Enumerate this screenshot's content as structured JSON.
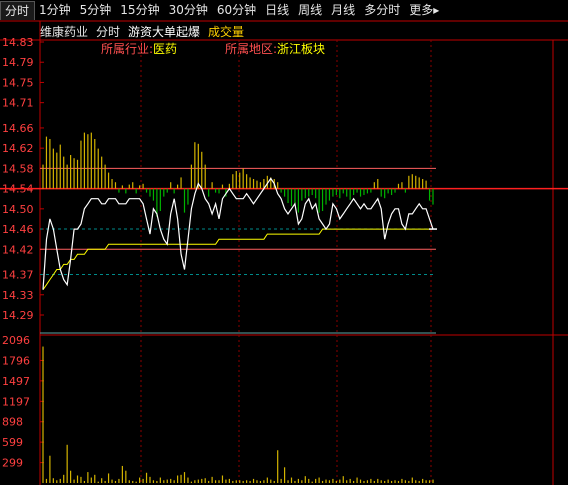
{
  "tabs": [
    {
      "label": "分时",
      "active": true
    },
    {
      "label": "1分钟"
    },
    {
      "label": "5分钟"
    },
    {
      "label": "15分钟"
    },
    {
      "label": "30分钟"
    },
    {
      "label": "60分钟"
    },
    {
      "label": "日线"
    },
    {
      "label": "周线"
    },
    {
      "label": "月线"
    },
    {
      "label": "多分时"
    },
    {
      "label": "更多▸"
    }
  ],
  "info": {
    "stock_name": "维康药业",
    "mode": "分时",
    "hot_flag": "游资大单起爆",
    "volume_label": "成交量",
    "industry_label": "所属行业:",
    "industry_value": "医药",
    "region_label": "所属地区:",
    "region_value": "浙江板块"
  },
  "colors": {
    "price_line": "#ffffff",
    "avg_line": "#ffff00",
    "up_bar": "#d4b400",
    "down_bar": "#00b400",
    "frame": "#c00000",
    "axis_text": "#ff4040",
    "volume_bar": "#d4b400"
  },
  "chart_data": [
    {
      "type": "line",
      "title": "",
      "y_ticks": [
        "14.83",
        "14.79",
        "14.75",
        "14.71",
        "14.66",
        "14.62",
        "14.58",
        "14.54",
        "14.50",
        "14.46",
        "14.42",
        "14.37",
        "14.33",
        "14.29"
      ],
      "ylim": [
        14.27,
        14.84
      ],
      "prev_close": 14.54,
      "reference_lines": [
        14.58,
        14.42
      ],
      "series": [
        {
          "key": "price",
          "values": [
            14.34,
            14.44,
            14.48,
            14.46,
            14.42,
            14.38,
            14.36,
            14.35,
            14.4,
            14.46,
            14.46,
            14.47,
            14.5,
            14.51,
            14.52,
            14.52,
            14.52,
            14.51,
            14.51,
            14.52,
            14.52,
            14.52,
            14.51,
            14.51,
            14.51,
            14.52,
            14.52,
            14.52,
            14.52,
            14.51,
            14.48,
            14.45,
            14.5,
            14.49,
            14.46,
            14.44,
            14.43,
            14.49,
            14.52,
            14.48,
            14.41,
            14.38,
            14.44,
            14.5,
            14.53,
            14.55,
            14.54,
            14.52,
            14.51,
            14.49,
            14.51,
            14.48,
            14.52,
            14.53,
            14.54,
            14.53,
            14.52,
            14.52,
            14.52,
            14.53,
            14.52,
            14.51,
            14.52,
            14.53,
            14.54,
            14.55,
            14.56,
            14.55,
            14.53,
            14.52,
            14.5,
            14.49,
            14.5,
            14.51,
            14.47,
            14.48,
            14.51,
            14.52,
            14.5,
            14.51,
            14.48,
            14.47,
            14.46,
            14.47,
            14.51,
            14.5,
            14.48,
            14.49,
            14.5,
            14.51,
            14.52,
            14.51,
            14.5,
            14.51,
            14.5,
            14.5,
            14.51,
            14.52,
            14.5,
            14.44,
            14.47,
            14.49,
            14.5,
            14.5,
            14.47,
            14.46,
            14.49,
            14.49,
            14.5,
            14.51,
            14.5,
            14.5,
            14.48,
            14.46
          ]
        },
        {
          "key": "average",
          "values": [
            14.34,
            14.35,
            14.36,
            14.37,
            14.38,
            14.38,
            14.39,
            14.39,
            14.4,
            14.4,
            14.41,
            14.41,
            14.41,
            14.42,
            14.42,
            14.42,
            14.42,
            14.42,
            14.42,
            14.43,
            14.43,
            14.43,
            14.43,
            14.43,
            14.43,
            14.43,
            14.43,
            14.43,
            14.43,
            14.43,
            14.43,
            14.43,
            14.43,
            14.43,
            14.43,
            14.43,
            14.43,
            14.43,
            14.43,
            14.43,
            14.43,
            14.43,
            14.43,
            14.43,
            14.43,
            14.43,
            14.43,
            14.43,
            14.43,
            14.43,
            14.43,
            14.44,
            14.44,
            14.44,
            14.44,
            14.44,
            14.44,
            14.44,
            14.44,
            14.44,
            14.44,
            14.44,
            14.44,
            14.44,
            14.44,
            14.45,
            14.45,
            14.45,
            14.45,
            14.45,
            14.45,
            14.45,
            14.45,
            14.45,
            14.45,
            14.45,
            14.45,
            14.45,
            14.45,
            14.45,
            14.45,
            14.46,
            14.46,
            14.46,
            14.46,
            14.46,
            14.46,
            14.46,
            14.46,
            14.46,
            14.46,
            14.46,
            14.46,
            14.46,
            14.46,
            14.46,
            14.46,
            14.46,
            14.46,
            14.46,
            14.46,
            14.46,
            14.46,
            14.46,
            14.46,
            14.46,
            14.46,
            14.46,
            14.46,
            14.46,
            14.46,
            14.46,
            14.46,
            14.46
          ]
        }
      ],
      "strength_bars": [
        0.3,
        0.65,
        0.62,
        0.5,
        0.45,
        0.55,
        0.4,
        0.3,
        0.42,
        0.38,
        0.36,
        0.6,
        0.7,
        0.68,
        0.7,
        0.62,
        0.5,
        0.4,
        0.3,
        0.2,
        0.12,
        0.08,
        -0.05,
        0.04,
        -0.06,
        0.05,
        0.08,
        -0.06,
        0.04,
        0.06,
        -0.05,
        -0.1,
        -0.15,
        -0.35,
        -0.28,
        -0.1,
        -0.05,
        0.08,
        -0.06,
        0.05,
        0.14,
        -0.3,
        -0.2,
        0.3,
        0.58,
        0.56,
        0.46,
        0.3,
        -0.1,
        0.08,
        -0.05,
        -0.06,
        0.05,
        -0.1,
        0.06,
        0.18,
        0.22,
        0.2,
        0.25,
        0.18,
        0.14,
        0.12,
        0.1,
        0.08,
        0.12,
        0.16,
        0.14,
        0.12,
        0.08,
        -0.05,
        -0.1,
        -0.18,
        -0.22,
        -0.2,
        -0.3,
        -0.15,
        -0.12,
        -0.1,
        -0.08,
        -0.12,
        -0.3,
        -0.28,
        -0.2,
        -0.15,
        -0.1,
        -0.08,
        -0.12,
        -0.06,
        -0.1,
        -0.14,
        -0.08,
        -0.05,
        -0.1,
        -0.08,
        -0.06,
        -0.05,
        0.08,
        0.12,
        -0.1,
        -0.12,
        -0.06,
        -0.08,
        -0.05,
        0.06,
        0.08,
        -0.05,
        0.16,
        0.18,
        0.16,
        0.14,
        0.12,
        0.1,
        -0.15,
        -0.2
      ]
    },
    {
      "type": "bar",
      "title": "成交量",
      "y_ticks": [
        "2096",
        "1796",
        "1497",
        "1197",
        "898",
        "599",
        "299"
      ],
      "ylim": [
        0,
        2096
      ],
      "values": [
        2000,
        60,
        400,
        70,
        40,
        60,
        120,
        560,
        180,
        50,
        110,
        90,
        30,
        160,
        80,
        120,
        20,
        70,
        30,
        140,
        50,
        30,
        60,
        250,
        180,
        40,
        30,
        20,
        80,
        60,
        150,
        90,
        40,
        30,
        80,
        40,
        50,
        60,
        40,
        110,
        120,
        160,
        80,
        20,
        40,
        50,
        60,
        70,
        30,
        90,
        40,
        40,
        110,
        50,
        60,
        30,
        40,
        40,
        30,
        40,
        30,
        60,
        40,
        30,
        40,
        80,
        50,
        30,
        480,
        60,
        230,
        40,
        80,
        30,
        60,
        40,
        100,
        60,
        20,
        60,
        80,
        30,
        50,
        40,
        60,
        30,
        50,
        100,
        40,
        60,
        30,
        80,
        50,
        30,
        40,
        60,
        30,
        60,
        40,
        30,
        50,
        30,
        40,
        30,
        60,
        40,
        30,
        80,
        40,
        30,
        60,
        40,
        40,
        50
      ]
    }
  ]
}
